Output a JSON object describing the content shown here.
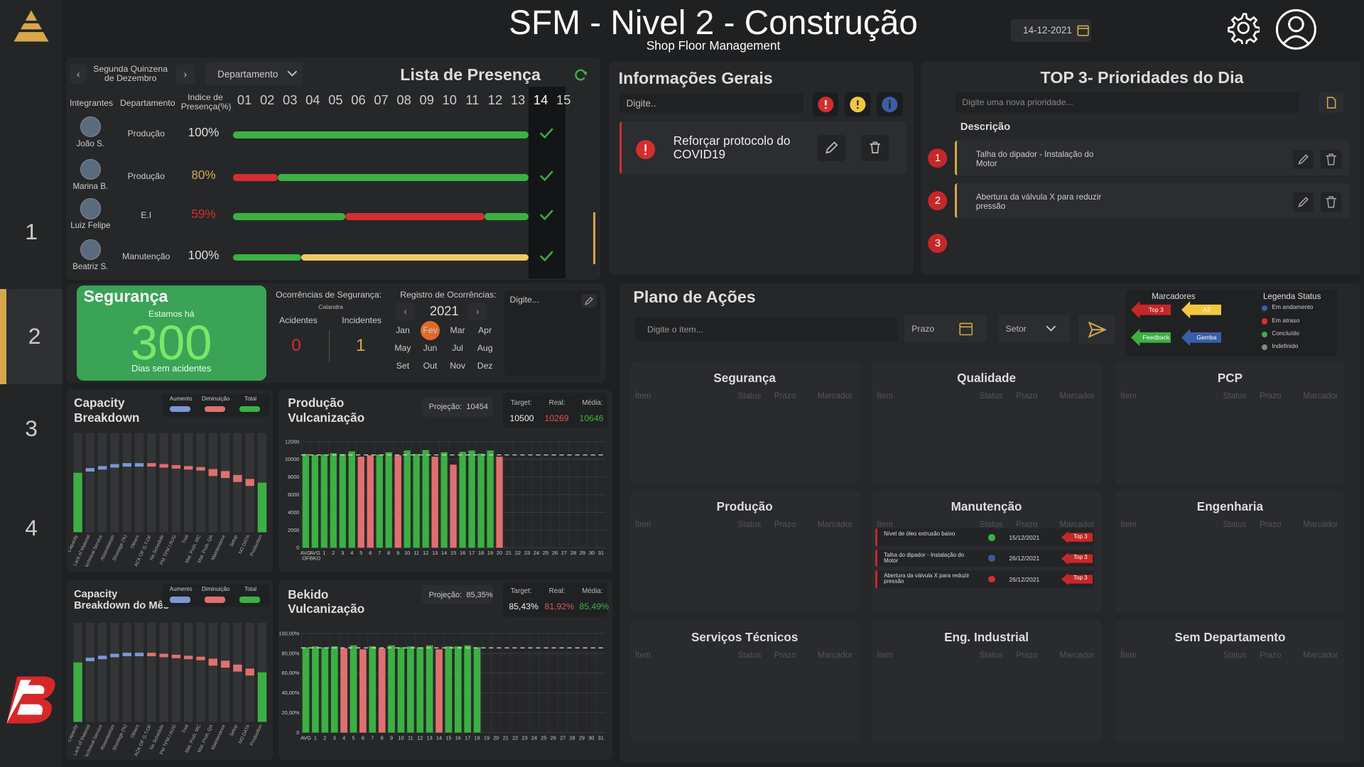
{
  "header": {
    "title": "SFM - Nivel 2 - Construção",
    "subtitle": "Shop Floor Management",
    "date": "14-12-2021"
  },
  "sidebar": {
    "items": [
      {
        "label": "1"
      },
      {
        "label": "2"
      },
      {
        "label": "3"
      },
      {
        "label": "4"
      }
    ]
  },
  "presence": {
    "title": "Lista de Presença",
    "period": "Segunda Quinzena de Dezembro",
    "dept_select": "Departamento",
    "col_members": "Integrantes",
    "col_dept": "Departamento",
    "col_index": "Indice de Presença(%)",
    "days": [
      "01",
      "02",
      "03",
      "04",
      "05",
      "06",
      "07",
      "08",
      "09",
      "10",
      "11",
      "12",
      "13",
      "14",
      "15"
    ],
    "rows": [
      {
        "name": "João S.",
        "dept": "Produção",
        "index": "100%"
      },
      {
        "name": "Marina B.",
        "dept": "Produção",
        "index": "80%"
      },
      {
        "name": "Luiz Felipe",
        "dept": "E.I",
        "index": "59%"
      },
      {
        "name": "Beatriz S.",
        "dept": "Manutenção",
        "index": "100%"
      }
    ]
  },
  "info": {
    "title": "Informações Gerais",
    "input_placeholder": "Digite..",
    "item_text": "Reforçar protocolo do COVID19"
  },
  "top3": {
    "title": "TOP 3- Prioridades do Dia",
    "input_placeholder": "Digite uma nova prioridade...",
    "desc_label": "Descrição",
    "items": [
      {
        "num": "1",
        "text": "Talha do dipador - Instalação do Motor"
      },
      {
        "num": "2",
        "text": "Abertura da válvula X para reduzir pressão"
      },
      {
        "num": "3",
        "text": ""
      }
    ]
  },
  "safety": {
    "title": "Segurança",
    "pre": "Estamos há",
    "days": "300",
    "post": "Dias sem acidentes",
    "occ_label": "Ocorrências de Segurança:",
    "cal_small": "Calandra",
    "acc_label": "Acidentes",
    "inc_label": "Incidentes",
    "acc_value": "0",
    "inc_value": "1",
    "reg_label": "Registro de Ocorrências:",
    "year": "2021",
    "months": [
      "Jan",
      "Fev",
      "Mar",
      "Apr",
      "May",
      "Jun",
      "Jul",
      "Aug",
      "Set",
      "Out",
      "Nov",
      "Dez"
    ],
    "note_placeholder": "Digite..."
  },
  "capacity": {
    "title1": "Capacity",
    "title2": "Breakdown",
    "month_title1": "Capacity",
    "month_title2": "Breakdown do Mês",
    "legend": [
      "Aumento",
      "Diminuição",
      "Total"
    ],
    "categories": [
      "Capacity",
      "Lack of Material",
      "Technical Service",
      "Absenteeism",
      "Shortage (%)",
      "Others",
      "LACK OF G.T.OF",
      "No Schedule",
      "PM TPM / AUG",
      "Trial",
      "Mat. Proh. MC",
      "Mat. Proh. QA",
      "Maintenance",
      "Setup",
      "NO DATA",
      "Production"
    ]
  },
  "prod": {
    "title1": "Produção",
    "title2": "Vulcanização",
    "proj_label": "Projeção:",
    "proj_value": "10454",
    "target_label": "Target:",
    "real_label": "Real:",
    "avg_label": "Média:",
    "target": "10500",
    "real": "10269",
    "avg": "10646"
  },
  "bekido": {
    "title1": "Bekido",
    "title2": "Vulcanização",
    "proj_label": "Projeção:",
    "proj_value": "85,35%",
    "target_label": "Target:",
    "real_label": "Real:",
    "avg_label": "Média:",
    "target": "85,43%",
    "real": "81,92%",
    "avg": "85,49%"
  },
  "chart_data": [
    {
      "type": "bar",
      "title": "Produção Vulcanização",
      "ylim": [
        0,
        12000
      ],
      "yticks": [
        "12000",
        "10000",
        "8000",
        "6000",
        "4000",
        "2000",
        "0"
      ],
      "categories": [
        "AVG OF",
        "AVG BKO",
        "1",
        "2",
        "3",
        "4",
        "5",
        "6",
        "7",
        "8",
        "9",
        "10",
        "11",
        "12",
        "13",
        "14",
        "15",
        "16",
        "17",
        "18",
        "19",
        "20",
        "21",
        "22",
        "23",
        "24",
        "25",
        "26",
        "27",
        "28",
        "29",
        "30",
        "31"
      ],
      "values": [
        10600,
        10500,
        10550,
        10700,
        10600,
        10900,
        10300,
        10450,
        10550,
        10800,
        10450,
        11000,
        10600,
        11050,
        10300,
        10800,
        9400,
        10850,
        11000,
        10650,
        11000,
        10300,
        null,
        null,
        null,
        null,
        null,
        null,
        null,
        null,
        null,
        null,
        null
      ],
      "target": 10500
    },
    {
      "type": "bar",
      "title": "Bekido Vulcanização",
      "ylim": [
        0,
        100
      ],
      "yticks": [
        "100,00%",
        "80,00%",
        "60,00%",
        "40,00%",
        "20,00%",
        "0"
      ],
      "categories": [
        "AVG",
        "1",
        "2",
        "3",
        "4",
        "5",
        "6",
        "7",
        "8",
        "9",
        "10",
        "11",
        "12",
        "13",
        "14",
        "15",
        "16",
        "17",
        "18",
        "19",
        "20",
        "21",
        "22",
        "23",
        "24",
        "25",
        "26",
        "27",
        "28",
        "29",
        "30",
        "31"
      ],
      "values": [
        86,
        87,
        86,
        87,
        85,
        88,
        84,
        87,
        85,
        88,
        86,
        87,
        86,
        88,
        84,
        87,
        87,
        88,
        86,
        null,
        null,
        null,
        null,
        null,
        null,
        null,
        null,
        null,
        null,
        null,
        null,
        null
      ],
      "target": 85.4
    }
  ],
  "plan": {
    "title": "Plano de Ações",
    "input_placeholder": "Digite o ítem...",
    "deadline": "Prazo",
    "sector": "Setor",
    "markers_title": "Marcadores",
    "markers": [
      "Top 3",
      "A3",
      "Feedback",
      "Gemba"
    ],
    "status_title": "Legenda Status",
    "statuses": [
      "Em andamento",
      "Em atraso",
      "Concluído",
      "Indefinido"
    ],
    "col_item": "Ítem",
    "col_status": "Status",
    "col_deadline": "Prazo",
    "col_marker": "Marcador",
    "sectors": [
      "Segurança",
      "Qualidade",
      "PCP",
      "Produção",
      "Manutenção",
      "Engenharia",
      "Serviços Técnicos",
      "Eng. Industrial",
      "Sem Departamento"
    ],
    "maint_rows": [
      {
        "item": "Nível de óleo extrusão baixo",
        "date": "15/12/2021",
        "marker": "Top 3",
        "status_color": "#3cb043"
      },
      {
        "item": "Talha do dipador - Instalação do Motor",
        "date": "26/12/2021",
        "marker": "Top 3",
        "status_color": "#3b5998"
      },
      {
        "item": "Abertura da válvula X para reduzir pressão",
        "date": "26/12/2021",
        "marker": "Top 3",
        "status_color": "#d32f2f"
      }
    ]
  },
  "colors": {
    "accent": "#d4a84b",
    "green": "#3cb043",
    "red": "#d32f2f",
    "yellow": "#f0c842",
    "blue": "#3b5ea8"
  }
}
